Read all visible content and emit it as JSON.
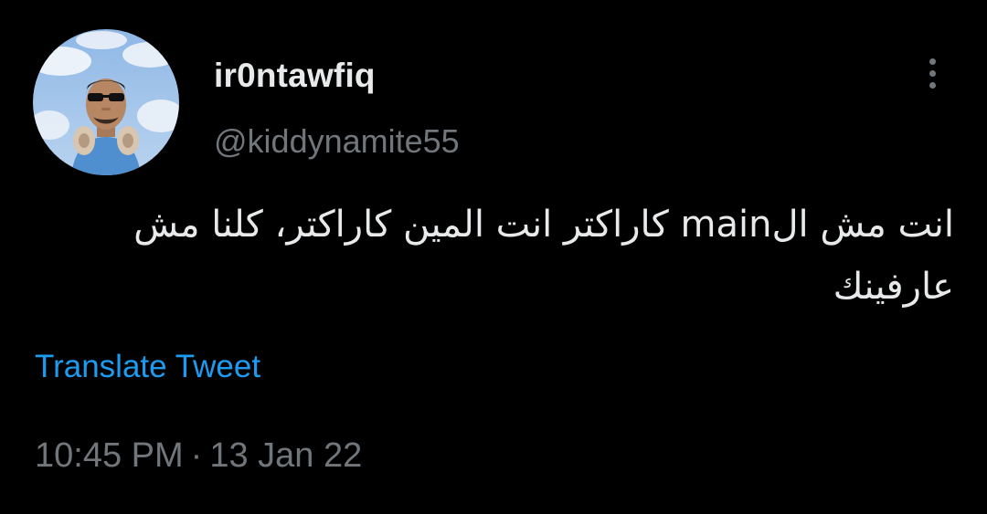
{
  "tweet": {
    "display_name": "ir0ntawfiq",
    "handle": "@kiddynamite55",
    "text_line1": "انت مش الmain كاراكتر انت المين كاراكتر، كلنا مش",
    "text_line2": "عارفينك",
    "translate_label": "Translate Tweet",
    "time": "10:45 PM",
    "separator": "·",
    "date": "13 Jan 22"
  },
  "colors": {
    "background": "#000000",
    "primary_text": "#e7e9ea",
    "secondary_text": "#71767b",
    "link": "#1d9bf0"
  },
  "icons": {
    "more": "more-vertical-icon",
    "avatar": "profile-avatar"
  }
}
